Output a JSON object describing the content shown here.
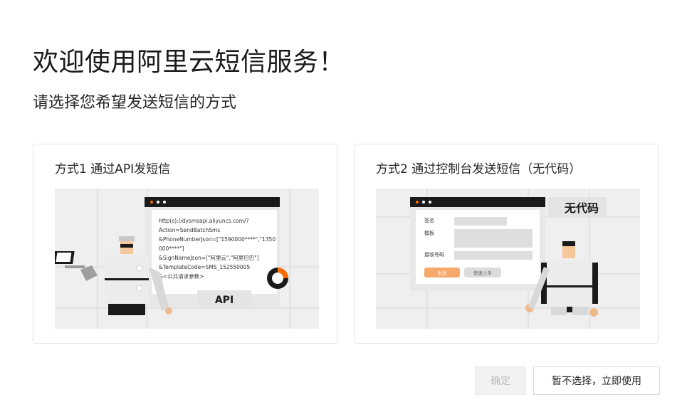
{
  "page": {
    "title": "欢迎使用阿里云短信服务！",
    "subtitle": "请选择您希望发送短信的方式"
  },
  "options": [
    {
      "title": "方式1 通过API发短信",
      "illustration": {
        "code_lines": [
          "http(s)://dysmsapi.aliyuncs.com/?",
          "Action=SendBatchSms",
          "&PhoneNumberJson=[\"1590000****\",\"1350",
          "000****\"]",
          "&SignNameJson=[\"阿里云\",\"阿里巴巴\"]",
          "&TemplateCode=SMS_152550005",
          "&<公共请求参数>"
        ],
        "badge": "API"
      }
    },
    {
      "title": "方式2 通过控制台发送短信（无代码）",
      "illustration": {
        "badge": "无代码",
        "form_labels": [
          "签名",
          "模板",
          "接收号码"
        ],
        "send_label": "发送",
        "quick_start_label": "快速上手"
      }
    }
  ],
  "buttons": {
    "confirm": "确定",
    "skip": "暂不选择，立即使用"
  },
  "colors": {
    "accent_orange": "#ff6a00",
    "disabled_bg": "#f2f2f2",
    "illustration_bg": "#efefef"
  }
}
